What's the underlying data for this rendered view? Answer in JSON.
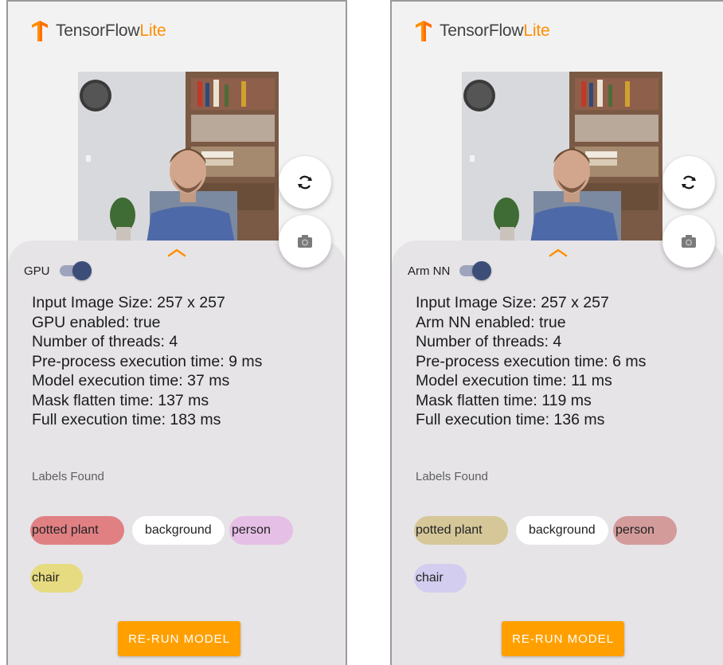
{
  "screens": [
    {
      "brand": {
        "name_main": "TensorFlow",
        "name_accent": "Lite"
      },
      "delegate_toggle": {
        "label": "GPU",
        "on": true
      },
      "stats": {
        "input_size": "Input Image Size: 257 x 257",
        "delegate_enabled": "GPU enabled: true",
        "threads": "Number of threads: 4",
        "preprocess": "Pre-process execution time: 9 ms",
        "model": "Model execution time: 37 ms",
        "mask": "Mask flatten time: 137 ms",
        "full": "Full execution time: 183 ms"
      },
      "labels_title": "Labels Found",
      "labels": [
        {
          "text": "potted plant",
          "color": "#e08083"
        },
        {
          "text": "background",
          "color": "#ffffff"
        },
        {
          "text": "person",
          "color": "#e6bfe6"
        },
        {
          "text": "chair",
          "color": "#e6db80"
        }
      ],
      "rerun_label": "RE-RUN MODEL"
    },
    {
      "brand": {
        "name_main": "TensorFlow",
        "name_accent": "Lite"
      },
      "delegate_toggle": {
        "label": "Arm NN",
        "on": true
      },
      "stats": {
        "input_size": "Input Image Size: 257 x 257",
        "delegate_enabled": "Arm NN enabled: true",
        "threads": "Number of threads: 4",
        "preprocess": "Pre-process execution time: 6 ms",
        "model": "Model execution time: 11 ms",
        "mask": "Mask flatten time: 119 ms",
        "full": "Full execution time: 136 ms"
      },
      "labels_title": "Labels Found",
      "labels": [
        {
          "text": "potted plant",
          "color": "#d6c799"
        },
        {
          "text": "background",
          "color": "#ffffff"
        },
        {
          "text": "person",
          "color": "#d49b9b"
        },
        {
          "text": "chair",
          "color": "#d3cdef"
        }
      ],
      "rerun_label": "RE-RUN MODEL"
    }
  ],
  "icons": {
    "brand_logo": "tensorflow-logo-icon",
    "switch_camera": "refresh-icon",
    "capture": "camera-icon",
    "expand": "chevron-up-icon"
  },
  "colors": {
    "accent": "#ff8f00",
    "button": "#ffa000",
    "sheet": "#e6e4e7",
    "toggle_thumb": "#3c4d78"
  }
}
